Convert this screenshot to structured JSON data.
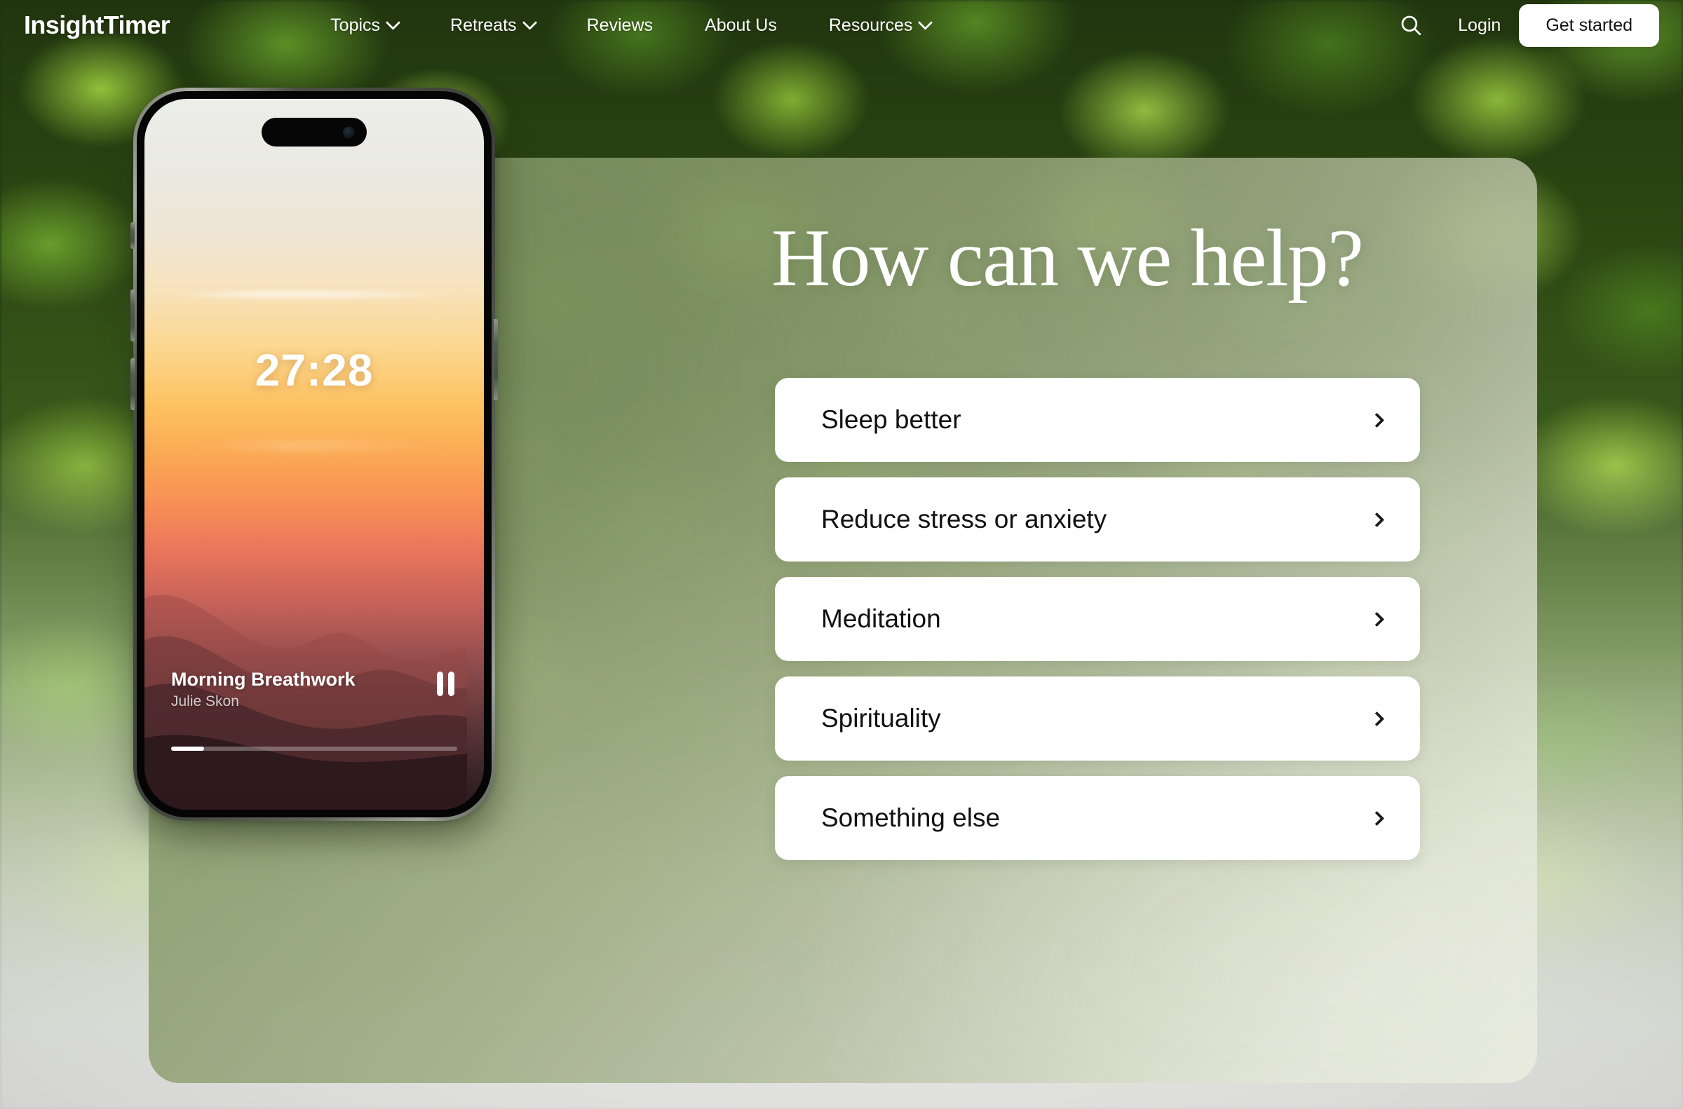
{
  "brand": {
    "logo_text": "InsightTimer"
  },
  "nav": {
    "items": [
      {
        "label": "Topics",
        "has_caret": true
      },
      {
        "label": "Retreats",
        "has_caret": true
      },
      {
        "label": "Reviews",
        "has_caret": false
      },
      {
        "label": "About Us",
        "has_caret": false
      },
      {
        "label": "Resources",
        "has_caret": true
      }
    ],
    "search_icon": "search-icon",
    "login_label": "Login",
    "cta_label": "Get started"
  },
  "hero": {
    "headline": "How can we help?",
    "options": [
      {
        "label": "Sleep better",
        "chevron": "chevron-right-icon"
      },
      {
        "label": "Reduce stress or anxiety",
        "chevron": "chevron-right-icon"
      },
      {
        "label": "Meditation",
        "chevron": "chevron-right-icon"
      },
      {
        "label": "Spirituality",
        "chevron": "chevron-right-icon"
      },
      {
        "label": "Something else",
        "chevron": "chevron-right-icon"
      }
    ]
  },
  "phone": {
    "timer": "27:28",
    "track_title": "Morning Breathwork",
    "track_artist": "Julie Skon",
    "player_control": "pause-icon",
    "progress_percent": 11.5
  },
  "colors": {
    "cta_bg": "#ffffff",
    "cta_text": "#111111",
    "option_bg": "#ffffff",
    "option_text": "#111111",
    "nav_text": "#ffffff",
    "headline_text": "#ffffff",
    "glass_tint": "#8c9e70"
  }
}
